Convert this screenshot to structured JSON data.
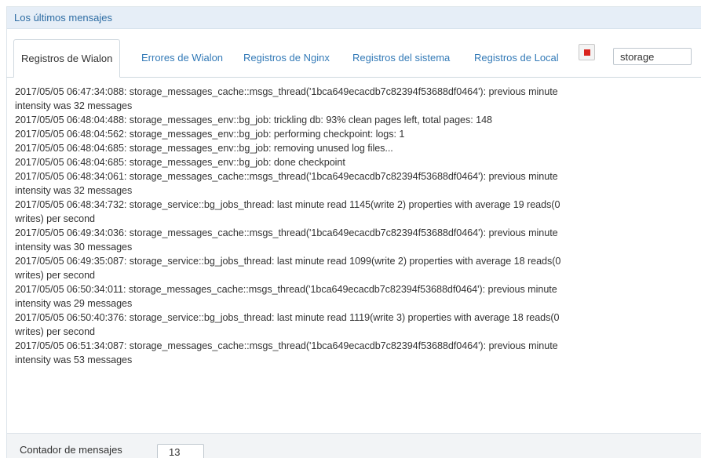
{
  "panel": {
    "title": "Los últimos mensajes"
  },
  "tabs": {
    "active": "Registros de Wialon",
    "links": [
      "Errores de Wialon",
      "Registros de Nginx",
      "Registros del sistema",
      "Registros de Local"
    ]
  },
  "filter": {
    "value": "storage"
  },
  "colors": {
    "accent": "#337ab7",
    "stop": "#d9231d",
    "header_bg": "#e6eef7"
  },
  "icons": {
    "stop": "stop-square-icon"
  },
  "log_lines": [
    "2017/05/05 06:47:34:088: storage_messages_cache::msgs_thread('1bca649ecacdb7c82394f53688df0464'): previous minute",
    "intensity was 32 messages",
    "2017/05/05 06:48:04:488: storage_messages_env::bg_job: trickling db: 93% clean pages left, total pages: 148",
    "2017/05/05 06:48:04:562: storage_messages_env::bg_job: performing checkpoint: logs: 1",
    "2017/05/05 06:48:04:685: storage_messages_env::bg_job: removing unused log files...",
    "2017/05/05 06:48:04:685: storage_messages_env::bg_job: done checkpoint",
    "2017/05/05 06:48:34:061: storage_messages_cache::msgs_thread('1bca649ecacdb7c82394f53688df0464'): previous minute",
    "intensity was 32 messages",
    "2017/05/05 06:48:34:732: storage_service::bg_jobs_thread: last minute read 1145(write 2) properties with average 19 reads(0",
    "writes) per second",
    "2017/05/05 06:49:34:036: storage_messages_cache::msgs_thread('1bca649ecacdb7c82394f53688df0464'): previous minute",
    "intensity was 30 messages",
    "2017/05/05 06:49:35:087: storage_service::bg_jobs_thread: last minute read 1099(write 2) properties with average 18 reads(0",
    "writes) per second",
    "2017/05/05 06:50:34:011: storage_messages_cache::msgs_thread('1bca649ecacdb7c82394f53688df0464'): previous minute",
    "intensity was 29 messages",
    "2017/05/05 06:50:40:376: storage_service::bg_jobs_thread: last minute read 1119(write 3) properties with average 18 reads(0",
    "writes) per second",
    "2017/05/05 06:51:34:087: storage_messages_cache::msgs_thread('1bca649ecacdb7c82394f53688df0464'): previous minute",
    "intensity was 53 messages"
  ],
  "footer": {
    "counter_label": "Contador de mensajes",
    "counter_value": "13"
  }
}
